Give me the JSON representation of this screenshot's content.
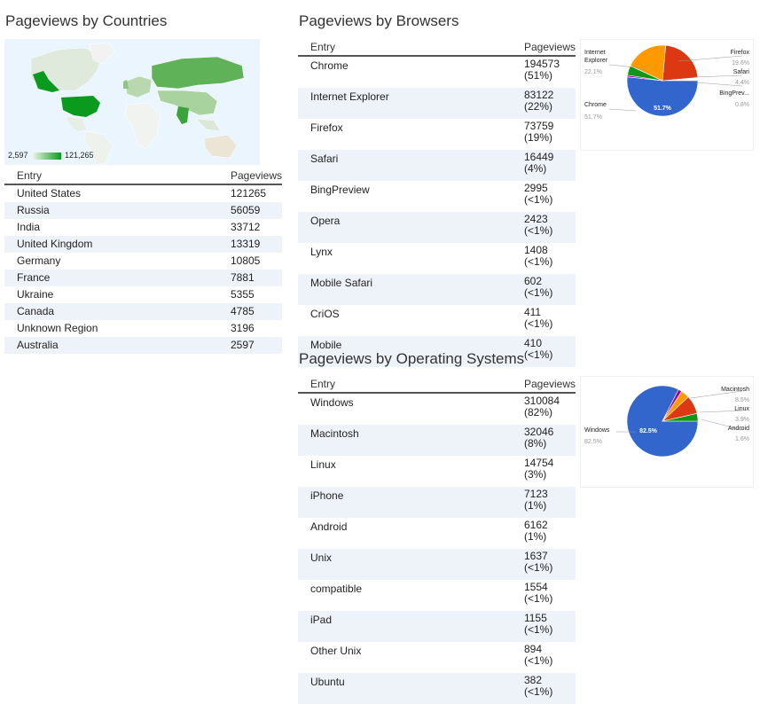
{
  "countries": {
    "title": "Pageviews by Countries",
    "legend": {
      "min": "2,597",
      "max": "121,265"
    },
    "table": {
      "headers": [
        "Entry",
        "Pageviews"
      ],
      "rows": [
        [
          "United States",
          "121265"
        ],
        [
          "Russia",
          "56059"
        ],
        [
          "India",
          "33712"
        ],
        [
          "United Kingdom",
          "13319"
        ],
        [
          "Germany",
          "10805"
        ],
        [
          "France",
          "7881"
        ],
        [
          "Ukraine",
          "5355"
        ],
        [
          "Canada",
          "4785"
        ],
        [
          "Unknown Region",
          "3196"
        ],
        [
          "Australia",
          "2597"
        ]
      ]
    }
  },
  "browsers": {
    "title": "Pageviews by Browsers",
    "table": {
      "headers": [
        "Entry",
        "Pageviews"
      ],
      "rows": [
        [
          "Chrome",
          "194573",
          "(51%)"
        ],
        [
          "Internet Explorer",
          "83122",
          "(22%)"
        ],
        [
          "Firefox",
          "73759",
          "(19%)"
        ],
        [
          "Safari",
          "16449",
          "(4%)"
        ],
        [
          "BingPreview",
          "2995",
          "(<1%)"
        ],
        [
          "Opera",
          "2423",
          "(<1%)"
        ],
        [
          "Lynx",
          "1408",
          "(<1%)"
        ],
        [
          "Mobile Safari",
          "602",
          "(<1%)"
        ],
        [
          "CriOS",
          "411",
          "(<1%)"
        ],
        [
          "Mobile",
          "410",
          "(<1%)"
        ]
      ]
    },
    "pie": {
      "slices": [
        {
          "label": "Chrome",
          "pct": 51.7,
          "pct_text": "51.7%",
          "color": "#3366cc"
        },
        {
          "label": "BingPrev...",
          "pct": 0.8,
          "pct_text": "0.8%",
          "color": "#990099"
        },
        {
          "label": "Safari",
          "pct": 4.4,
          "pct_text": "4.4%",
          "color": "#109618"
        },
        {
          "label": "Firefox",
          "pct": 19.6,
          "pct_text": "19.6%",
          "color": "#ff9900"
        },
        {
          "label": "Internet Explorer",
          "pct": 22.1,
          "pct_text": "22.1%",
          "color": "#dc3912"
        }
      ],
      "label_ie_line1": "Internet",
      "label_ie_line2": "Explorer"
    }
  },
  "os": {
    "title": "Pageviews by Operating Systems",
    "table": {
      "headers": [
        "Entry",
        "Pageviews"
      ],
      "rows": [
        [
          "Windows",
          "310084",
          "(82%)"
        ],
        [
          "Macintosh",
          "32046",
          "(8%)"
        ],
        [
          "Linux",
          "14754",
          "(3%)"
        ],
        [
          "iPhone",
          "7123",
          "(1%)"
        ],
        [
          "Android",
          "6162",
          "(1%)"
        ],
        [
          "Unix",
          "1637",
          "(<1%)"
        ],
        [
          "compatible",
          "1554",
          "(<1%)"
        ],
        [
          "iPad",
          "1155",
          "(<1%)"
        ],
        [
          "Other Unix",
          "894",
          "(<1%)"
        ],
        [
          "Ubuntu",
          "382",
          "(<1%)"
        ]
      ]
    },
    "pie": {
      "slices": [
        {
          "label": "Windows",
          "pct": 82.5,
          "pct_text": "82.5%",
          "color": "#3366cc"
        },
        {
          "label": "Android",
          "pct": 1.6,
          "pct_text": "1.6%",
          "color": "#990099"
        },
        {
          "label": "Linux",
          "pct": 3.9,
          "pct_text": "3.9%",
          "color": "#ff9900"
        },
        {
          "label": "Macintosh",
          "pct": 8.5,
          "pct_text": "8.5%",
          "color": "#dc3912"
        },
        {
          "label": "",
          "pct": 3.5,
          "pct_text": "",
          "color": "#109618"
        }
      ]
    }
  },
  "colors": {
    "header_rule": "#555555",
    "row_stripe": "#eef3f9",
    "map_water": "#eaf5fd",
    "map_high": "#0a9a1e"
  }
}
